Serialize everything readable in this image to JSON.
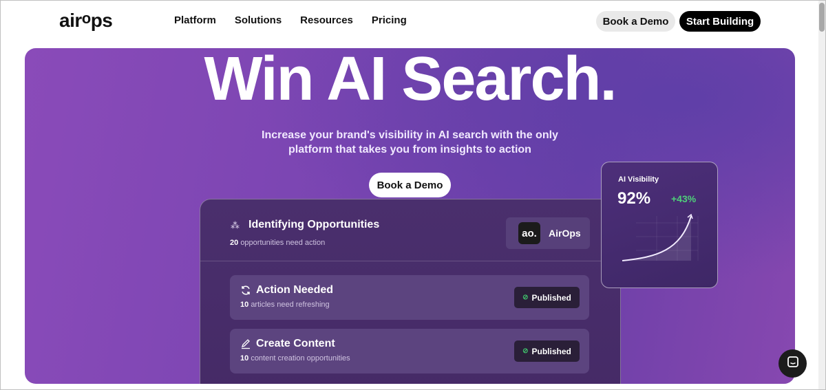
{
  "nav": {
    "logo_main": "airOps",
    "links": [
      "Platform",
      "Solutions",
      "Resources",
      "Pricing"
    ],
    "book_demo": "Book a Demo",
    "start_building": "Start Building"
  },
  "hero": {
    "headline": "Win AI Search.",
    "subtitle_line1": "Increase your brand's visibility in AI search with the only",
    "subtitle_line2": "platform that takes you from insights to action",
    "cta": "Book a Demo"
  },
  "panel": {
    "title": "Identifying Opportunities",
    "count": "20",
    "count_text": "opportunities need action",
    "brand_badge": "ao.",
    "brand_name": "AirOps",
    "rows": [
      {
        "title": "Action Needed",
        "count": "10",
        "text": "articles need refreshing",
        "status": "Published",
        "icon": "refresh-icon"
      },
      {
        "title": "Create Content",
        "count": "10",
        "text": "content creation opportunities",
        "status": "Published",
        "icon": "pencil-icon"
      }
    ]
  },
  "visibility": {
    "label": "AI Visibility",
    "value": "92%",
    "delta": "+43%"
  },
  "colors": {
    "accent": "#7a45b2",
    "positive": "#4fd07a",
    "dark": "#000000"
  }
}
